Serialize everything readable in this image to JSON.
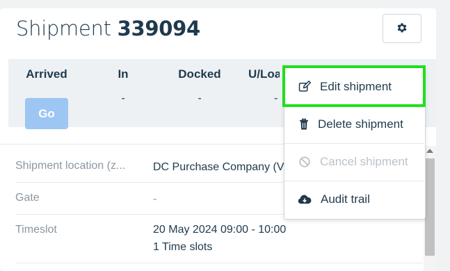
{
  "header": {
    "title_prefix": "Shipment",
    "shipment_number": "339094"
  },
  "status": {
    "columns": [
      {
        "label": "Arrived",
        "value": ""
      },
      {
        "label": "In",
        "value": "-"
      },
      {
        "label": "Docked",
        "value": "-"
      },
      {
        "label": "U/Loa",
        "value": "-"
      }
    ],
    "go_label": "Go"
  },
  "details": {
    "rows": [
      {
        "label": "Shipment location (z...",
        "value": "DC Purchase Company (V"
      },
      {
        "label": "Gate",
        "value": "-"
      },
      {
        "label": "Timeslot",
        "value": "20 May 2024 09:00 - 10:00",
        "value2": "1 Time slots"
      }
    ]
  },
  "menu": {
    "items": [
      {
        "label": "Edit shipment",
        "icon": "edit-icon",
        "disabled": false
      },
      {
        "label": "Delete shipment",
        "icon": "trash-icon",
        "disabled": false
      },
      {
        "label": "Cancel shipment",
        "icon": "cancel-icon",
        "disabled": true
      },
      {
        "label": "Audit trail",
        "icon": "cloud-download-icon",
        "disabled": false
      }
    ]
  },
  "colors": {
    "primary_text": "#1f3a4d",
    "go_button": "#9ec6f2",
    "highlight": "#1ee01e",
    "muted_text": "#8a97a1"
  }
}
